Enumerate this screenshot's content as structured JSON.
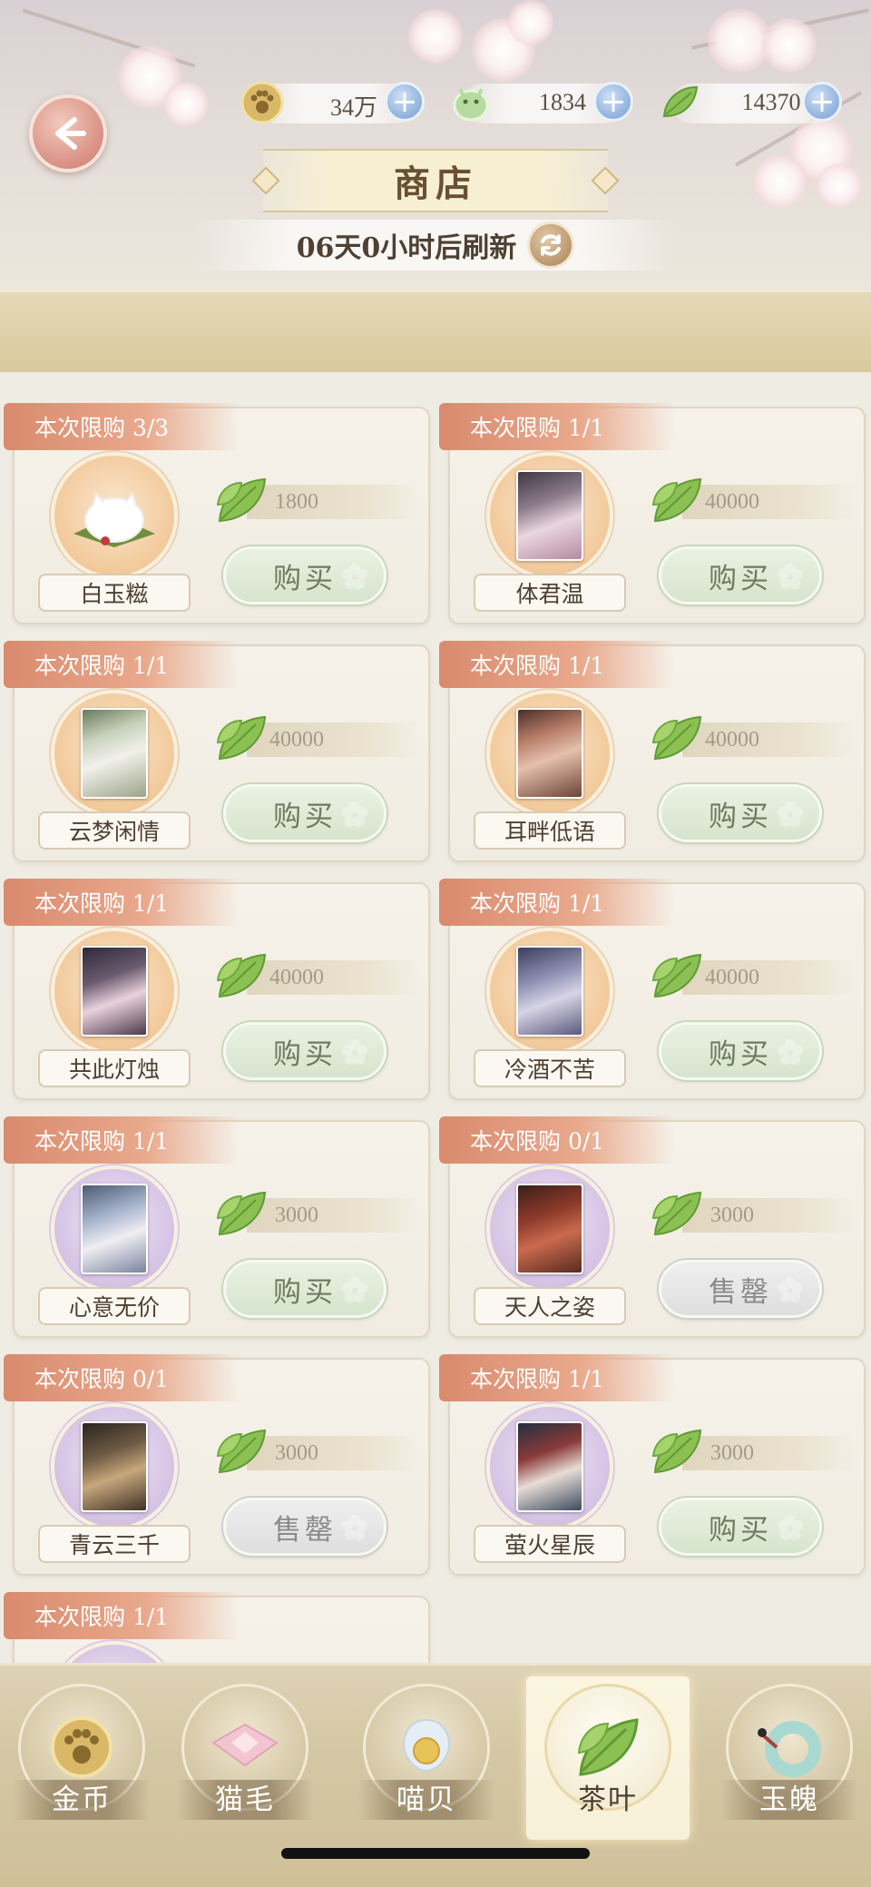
{
  "header": {
    "title": "商店",
    "refresh_text": "06天0小时后刷新"
  },
  "resources": [
    {
      "icon": "paw-coin-icon",
      "value": "34万"
    },
    {
      "icon": "jade-pet-icon",
      "value": "1834"
    },
    {
      "icon": "tea-leaf-icon",
      "value": "14370"
    }
  ],
  "items": [
    {
      "limit": "本次限购 3/3",
      "name": "白玉糍",
      "price": "1800",
      "button": "购买",
      "sold_out": false
    },
    {
      "limit": "本次限购 1/1",
      "name": "体君温",
      "price": "40000",
      "button": "购买",
      "sold_out": false
    },
    {
      "limit": "本次限购 1/1",
      "name": "云梦闲情",
      "price": "40000",
      "button": "购买",
      "sold_out": false
    },
    {
      "limit": "本次限购 1/1",
      "name": "耳畔低语",
      "price": "40000",
      "button": "购买",
      "sold_out": false
    },
    {
      "limit": "本次限购 1/1",
      "name": "共此灯烛",
      "price": "40000",
      "button": "购买",
      "sold_out": false
    },
    {
      "limit": "本次限购 1/1",
      "name": "冷酒不苦",
      "price": "40000",
      "button": "购买",
      "sold_out": false
    },
    {
      "limit": "本次限购 1/1",
      "name": "心意无价",
      "price": "3000",
      "button": "购买",
      "sold_out": false
    },
    {
      "limit": "本次限购 0/1",
      "name": "天人之姿",
      "price": "3000",
      "button": "售罄",
      "sold_out": true
    },
    {
      "limit": "本次限购 0/1",
      "name": "青云三千",
      "price": "3000",
      "button": "售罄",
      "sold_out": true
    },
    {
      "limit": "本次限购 1/1",
      "name": "萤火星辰",
      "price": "3000",
      "button": "购买",
      "sold_out": false
    },
    {
      "limit": "本次限购 1/1"
    }
  ],
  "tabs": [
    {
      "label": "金币",
      "icon": "gold-coin-icon"
    },
    {
      "label": "猫毛",
      "icon": "cat-fur-icon"
    },
    {
      "label": "喵贝",
      "icon": "meow-shell-icon"
    },
    {
      "label": "茶叶",
      "icon": "tea-leaf-icon",
      "active": true
    },
    {
      "label": "玉魄",
      "icon": "jade-ring-icon"
    }
  ]
}
